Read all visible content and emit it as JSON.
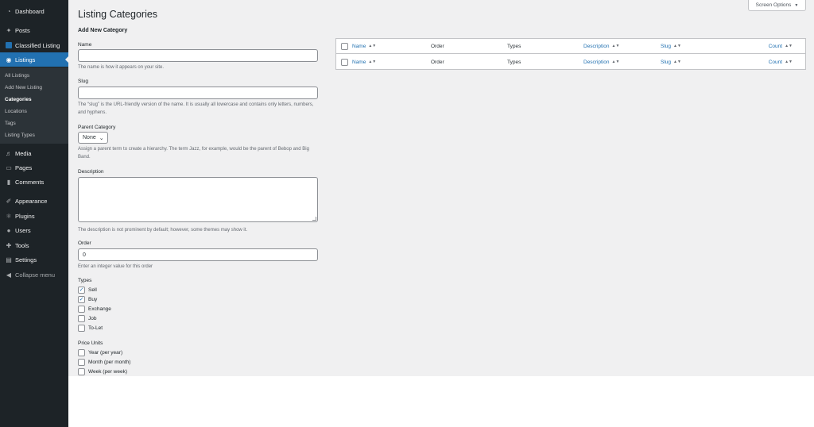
{
  "sidebar": {
    "menu": [
      {
        "label": "Dashboard",
        "icon": "dashboard-icon"
      },
      {
        "label": "Posts",
        "icon": "pin-icon"
      },
      {
        "label": "Classified Listing",
        "icon": "classified-icon"
      },
      {
        "label": "Listings",
        "icon": "location-icon"
      },
      {
        "label": "Media",
        "icon": "media-icon"
      },
      {
        "label": "Pages",
        "icon": "pages-icon"
      },
      {
        "label": "Comments",
        "icon": "comments-icon"
      },
      {
        "label": "Appearance",
        "icon": "brush-icon"
      },
      {
        "label": "Plugins",
        "icon": "plugins-icon"
      },
      {
        "label": "Users",
        "icon": "users-icon"
      },
      {
        "label": "Tools",
        "icon": "wrench-icon"
      },
      {
        "label": "Settings",
        "icon": "settings-icon"
      },
      {
        "label": "Collapse menu",
        "icon": "collapse-icon"
      }
    ],
    "submenu": [
      "All Listings",
      "Add New Listing",
      "Categories",
      "Locations",
      "Tags",
      "Listing Types"
    ]
  },
  "header": {
    "title": "Listing Categories",
    "screen_options": "Screen Options"
  },
  "form": {
    "heading": "Add New Category",
    "name_label": "Name",
    "name_value": "",
    "name_hint": "The name is how it appears on your site.",
    "slug_label": "Slug",
    "slug_value": "",
    "slug_hint": "The “slug” is the URL-friendly version of the name. It is usually all lowercase and contains only letters, numbers, and hyphens.",
    "parent_label": "Parent Category",
    "parent_selected": "None",
    "parent_hint": "Assign a parent term to create a hierarchy. The term Jazz, for example, would be the parent of Bebop and Big Band.",
    "description_label": "Description",
    "description_hint": "The description is not prominent by default; however, some themes may show it.",
    "order_label": "Order",
    "order_value": "0",
    "order_hint": "Enter an integer value for this order",
    "types_label": "Types",
    "types": [
      {
        "label": "Sell",
        "checked": true
      },
      {
        "label": "Buy",
        "checked": true
      },
      {
        "label": "Exchange",
        "checked": false
      },
      {
        "label": "Job",
        "checked": false
      },
      {
        "label": "To-Let",
        "checked": false
      }
    ],
    "price_units_label": "Price Units",
    "price_units": [
      {
        "label": "Year (per year)",
        "checked": false
      },
      {
        "label": "Month (per month)",
        "checked": false
      },
      {
        "label": "Week (per week)",
        "checked": false
      }
    ]
  },
  "table": {
    "columns": {
      "name": "Name",
      "order": "Order",
      "types": "Types",
      "description": "Description",
      "slug": "Slug",
      "count": "Count"
    }
  },
  "colors": {
    "sidebar_bg": "#1d2327",
    "accent": "#2271b1",
    "content_bg": "#f0f0f1"
  }
}
